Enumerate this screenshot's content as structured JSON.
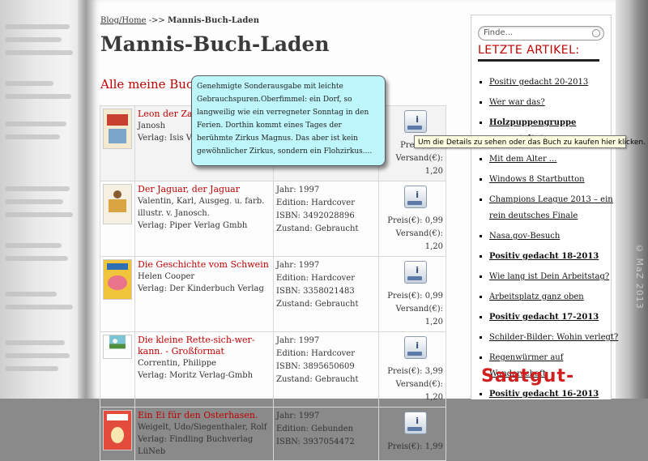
{
  "breadcrumb": {
    "home": "Blog/Home",
    "separator": "->>",
    "current": "Mannis-Buch-Laden"
  },
  "page_title": "Mannis-Buch-Laden",
  "section_heading": "Alle meine Bucha",
  "books": [
    {
      "title": "Leon der Zaub",
      "author": "Janosh",
      "publisher": "Verlag: Isis Ve",
      "details": [
        "",
        "",
        "",
        ""
      ],
      "price": "Preis(€): 1",
      "shipping": "Versand(€): 1,20"
    },
    {
      "title": "Der Jaguar, der Jaguar",
      "author": "Valentin, Karl, Ausgeg. u. farb. illustr. v. Janosch.",
      "publisher": "Verlag: Piper Verlag Gmbh",
      "details": [
        "Jahr: 1997",
        "Edition: Hardcover",
        "ISBN: 3492028896",
        "Zustand: Gebraucht"
      ],
      "price": "Preis(€): 0,99",
      "shipping": "Versand(€): 1,20"
    },
    {
      "title": "Die Geschichte vom Schwein",
      "author": "Helen Cooper",
      "publisher": "Verlag: Der Kinderbuch Verlag",
      "details": [
        "Jahr: 1997",
        "Edition: Hardcover",
        "ISBN: 3358021483",
        "Zustand: Gebraucht"
      ],
      "price": "Preis(€): 0,99",
      "shipping": "Versand(€): 1,20"
    },
    {
      "title": "Die kleine Rette-sich-wer-kann. - Großformat",
      "author": "Correntin, Philippe",
      "publisher": "Verlag: Moritz Verlag-Gmbh",
      "details": [
        "Jahr: 1997",
        "Edition: Hardcover",
        "ISBN: 3895650609",
        "Zustand: Gebraucht"
      ],
      "price": "Preis(€): 3,99",
      "shipping": "Versand(€): 1,20"
    },
    {
      "title": "Ein Ei für den Osterhasen.",
      "author": "Weigelt, Udo/Siegenthaler, Rolf",
      "publisher": "Verlag: Findling Buchverlag LüNeb",
      "details": [
        "Jahr: 1997",
        "Edition: Gebunden",
        "ISBN: 3937054472",
        ""
      ],
      "price": "Preis(€): 1,99",
      "shipping": ""
    }
  ],
  "popup": {
    "text": "Genehmigte Sonderausgabe mit leichte Gebrauchspuren.Oberfimmel: ein Dorf, so langweilig wie ein verregneter Sonntag in den Ferien. Dorthin kommt eines Tages der berühmte Zirkus Magnus. Das aber ist kein gewöhnlicher Zirkus, sondern ein Flohzirkus...."
  },
  "tooltip": {
    "text": "Um die Details zu sehen oder das Buch zu kaufen hier klicken."
  },
  "sidebar": {
    "search_placeholder": "Finde...",
    "heading": "LETZTE ARTIKEL:",
    "articles": [
      "Positiv gedacht 20-2013",
      "Wer war das?",
      "Holzpuppengruppe umgestaltet",
      "Mit dem Alter ...",
      "",
      "Windows 8 Startbutton",
      "Champions League 2013 – ein rein deutsches Finale",
      "Nasa.gov-Besuch",
      "Positiv gedacht 18-2013",
      "Wie lang ist Dein Arbeitstag?",
      "Arbeitsplatz ganz oben",
      "Positiv gedacht 17-2013",
      "Schilder-Bilder: Wohin verlegt?",
      "Regenwürmer auf Wanderschaft",
      "Positiv gedacht 16-2013"
    ],
    "promo": "Saatgut-"
  },
  "watermark": "© MaZ 2013",
  "colors": {
    "accent_red": "#c00000",
    "popup_bg": "#bdf7fb",
    "tooltip_bg": "#ffffe1"
  }
}
